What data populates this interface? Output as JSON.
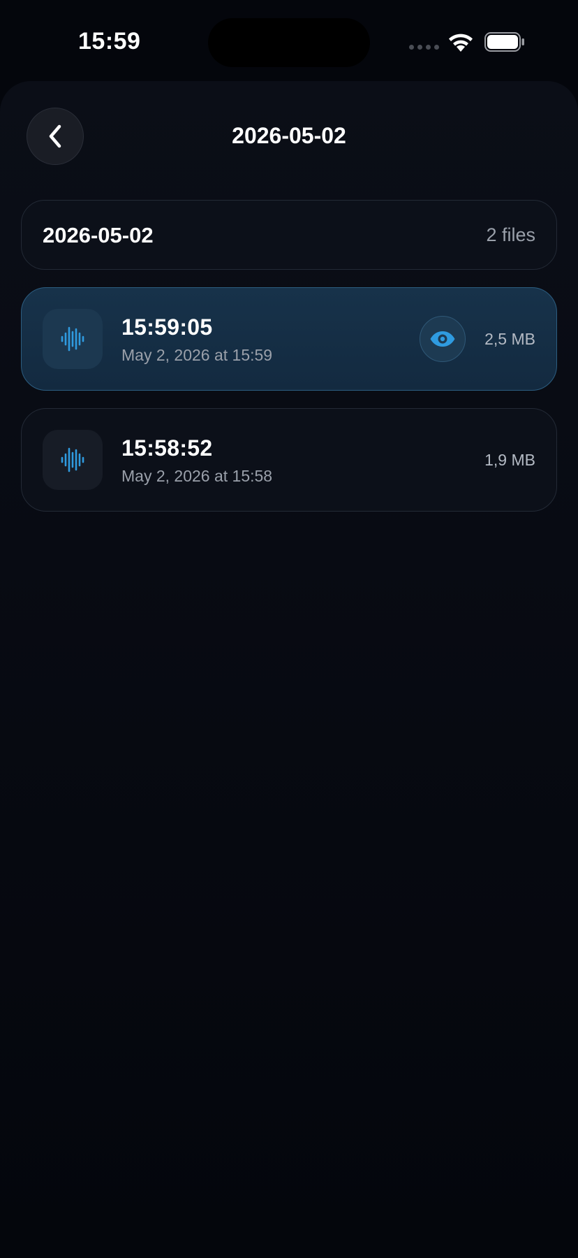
{
  "status_bar": {
    "time": "15:59"
  },
  "header": {
    "title": "2026-05-02",
    "back_icon": "chevron-left-icon"
  },
  "group": {
    "title": "2026-05-02",
    "count": "2 files"
  },
  "files": [
    {
      "title": "15:59:05",
      "subtitle": "May 2, 2026 at 15:59",
      "size": "2,5 MB",
      "icon": "waveform-icon",
      "selected": true,
      "action_icon": "eye-icon"
    },
    {
      "title": "15:58:52",
      "subtitle": "May 2, 2026 at 15:58",
      "size": "1,9 MB",
      "icon": "waveform-icon",
      "selected": false
    }
  ],
  "colors": {
    "background": "#04060c",
    "accent": "#2f9be0",
    "selected_row": "#17324a"
  }
}
